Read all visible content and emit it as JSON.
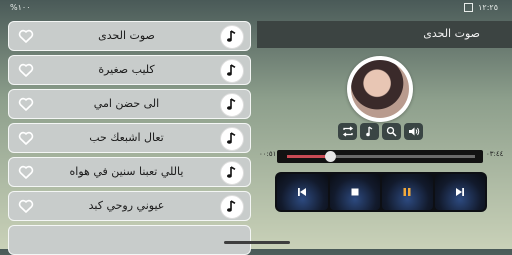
{
  "status": {
    "time": "١٢:٢٥",
    "battery": "%١٠٠"
  },
  "header": {
    "title": "صوت الحدى"
  },
  "songs": [
    {
      "title": "صوت الحدى"
    },
    {
      "title": "كليب صغيرة"
    },
    {
      "title": "الى حضن امي"
    },
    {
      "title": "تعال اشبعك حب"
    },
    {
      "title": "ياللي تعبنا سنين في هواه"
    },
    {
      "title": "عيوني روحي كبد"
    }
  ],
  "player": {
    "elapsed": "٠٠:٥١",
    "duration": "٠٣:٤٤",
    "progress": 0.23
  },
  "colors": {
    "accent": "#c94a54",
    "pause": "#f2a93b"
  },
  "icons": {
    "tools": [
      "repeat-icon",
      "music-note-icon",
      "search-icon",
      "volume-icon"
    ],
    "controls": [
      "previous-icon",
      "stop-icon",
      "pause-icon",
      "next-icon"
    ]
  }
}
